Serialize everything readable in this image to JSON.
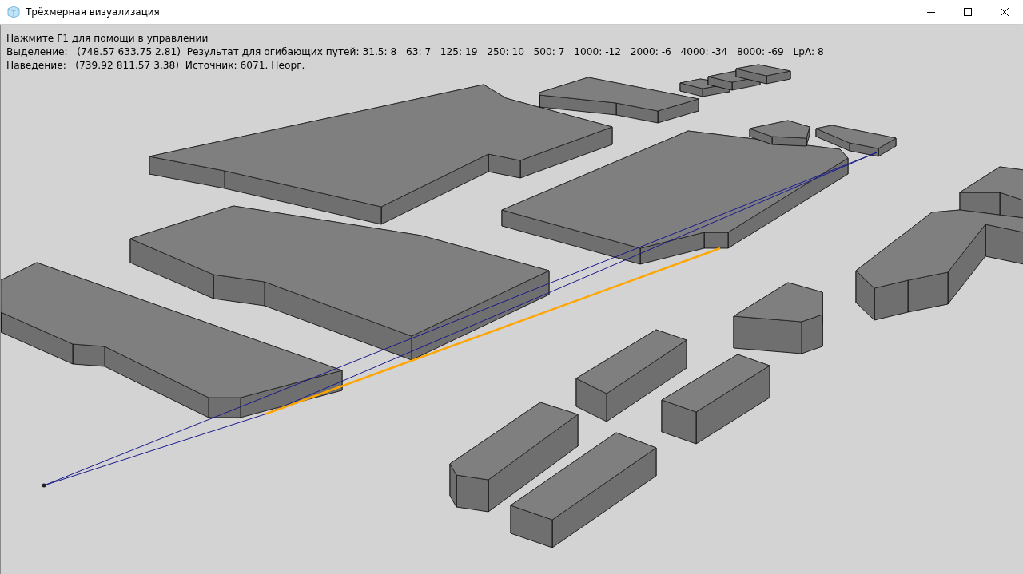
{
  "window": {
    "title": "Трёхмерная визуализация"
  },
  "info_lines": [
    "Нажмите F1 для помощи в управлении",
    "Выделение:   (748.57 633.75 2.81)  Результат для огибающих путей: 31.5: 8   63: 7   125: 19   250: 10   500: 7   1000: -12   2000: -6   4000: -34   8000: -69   LpA: 8",
    "Наведение:   (739.92 811.57 3.38)  Источник: 6071. Неорг."
  ]
}
